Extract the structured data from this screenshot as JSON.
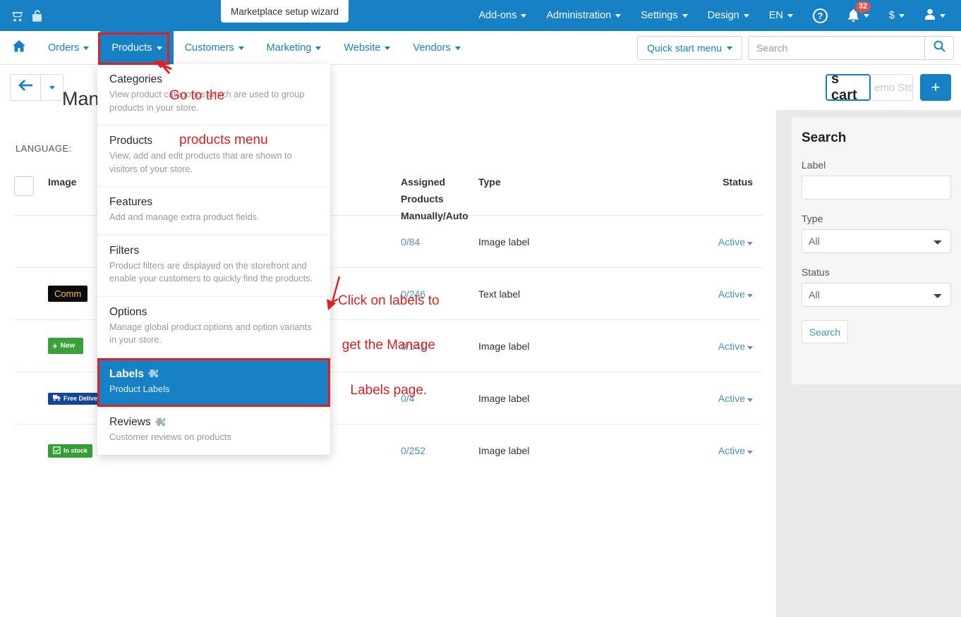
{
  "topbar": {
    "icons": [
      {
        "name": "cart-icon"
      },
      {
        "name": "unlock-icon"
      }
    ],
    "wizard_tooltip": "Marketplace setup wizard",
    "menus": [
      {
        "label": "Add-ons"
      },
      {
        "label": "Administration"
      },
      {
        "label": "Settings"
      },
      {
        "label": "Design"
      },
      {
        "label": "EN"
      }
    ],
    "help_label": "?",
    "notifications_count": "32",
    "currency_label": "$"
  },
  "navbar": {
    "home_icon": "home-icon",
    "items": [
      {
        "label": "Orders",
        "active": false
      },
      {
        "label": "Products",
        "active": true
      },
      {
        "label": "Customers",
        "active": false
      },
      {
        "label": "Marketing",
        "active": false
      },
      {
        "label": "Website",
        "active": false
      },
      {
        "label": "Vendors",
        "active": false
      }
    ],
    "quick_start_label": "Quick start menu",
    "search_placeholder": "Search",
    "search_value": ""
  },
  "titlebar": {
    "page_title": "Man",
    "store_button_a": "s cart",
    "store_button_b": "emo Sto",
    "add_button": "+"
  },
  "dropdown": {
    "items": [
      {
        "label": "Categories",
        "description": "View product categories which are used to group products in your store.",
        "addon": false,
        "selected": false
      },
      {
        "label": "Products",
        "description": "View, add and edit products that are shown to visitors of your store.",
        "addon": false,
        "selected": false
      },
      {
        "label": "Features",
        "description": "Add and manage extra product fields.",
        "addon": false,
        "selected": false
      },
      {
        "label": "Filters",
        "description": "Product filters are displayed on the storefront and enable your customers to quickly find the products.",
        "addon": false,
        "selected": false
      },
      {
        "label": "Options",
        "description": "Manage global product options and option variants in your store.",
        "addon": false,
        "selected": false
      },
      {
        "label": "Labels",
        "description": "Product Labels",
        "addon": true,
        "selected": true
      },
      {
        "label": "Reviews",
        "description": "Customer reviews on products",
        "addon": true,
        "selected": false
      }
    ]
  },
  "content": {
    "language_label": "LANGUAGE:",
    "table": {
      "columns": [
        "",
        "Image",
        "",
        "Assigned Products Manually/Auto",
        "Type",
        "Status"
      ],
      "header_image": "Image",
      "header_assigned_l1": "Assigned",
      "header_assigned_l2": "Products",
      "header_assigned_l3": "Manually/Auto",
      "header_type": "Type",
      "header_status": "Status",
      "rows": [
        {
          "badge_text": "",
          "badge_style": "none",
          "name": "",
          "assigned": "0/84",
          "type": "Image label",
          "status": "Active"
        },
        {
          "badge_text": "Comm",
          "badge_style": "black",
          "name": "",
          "assigned": "0/246",
          "type": "Text label",
          "status": "Active"
        },
        {
          "badge_text": "New",
          "badge_style": "green-new",
          "name": "",
          "assigned": "0/141",
          "type": "Image label",
          "status": "Active"
        },
        {
          "badge_text": "Free Delivery",
          "badge_style": "blue",
          "name": "Free delivery",
          "assigned": "0/4",
          "type": "Image label",
          "status": "Active"
        },
        {
          "badge_text": "In stock",
          "badge_style": "green",
          "name": "In stock",
          "assigned": "0/252",
          "type": "Image label",
          "status": "Active"
        }
      ]
    }
  },
  "sidebar": {
    "title": "Search",
    "label_field_label": "Label",
    "label_field_value": "",
    "type_field_label": "Type",
    "type_field_value": "All",
    "type_options": [
      "All"
    ],
    "status_field_label": "Status",
    "status_field_value": "All",
    "status_options": [
      "All"
    ],
    "search_button": "Search"
  },
  "annotations": {
    "note1_line1": "Go to the",
    "note1_line2": "products menu",
    "note2_line1": "Click on labels to",
    "note2_line2": "get the Manage",
    "note2_line3": "Labels page.",
    "color": "#e02020"
  }
}
